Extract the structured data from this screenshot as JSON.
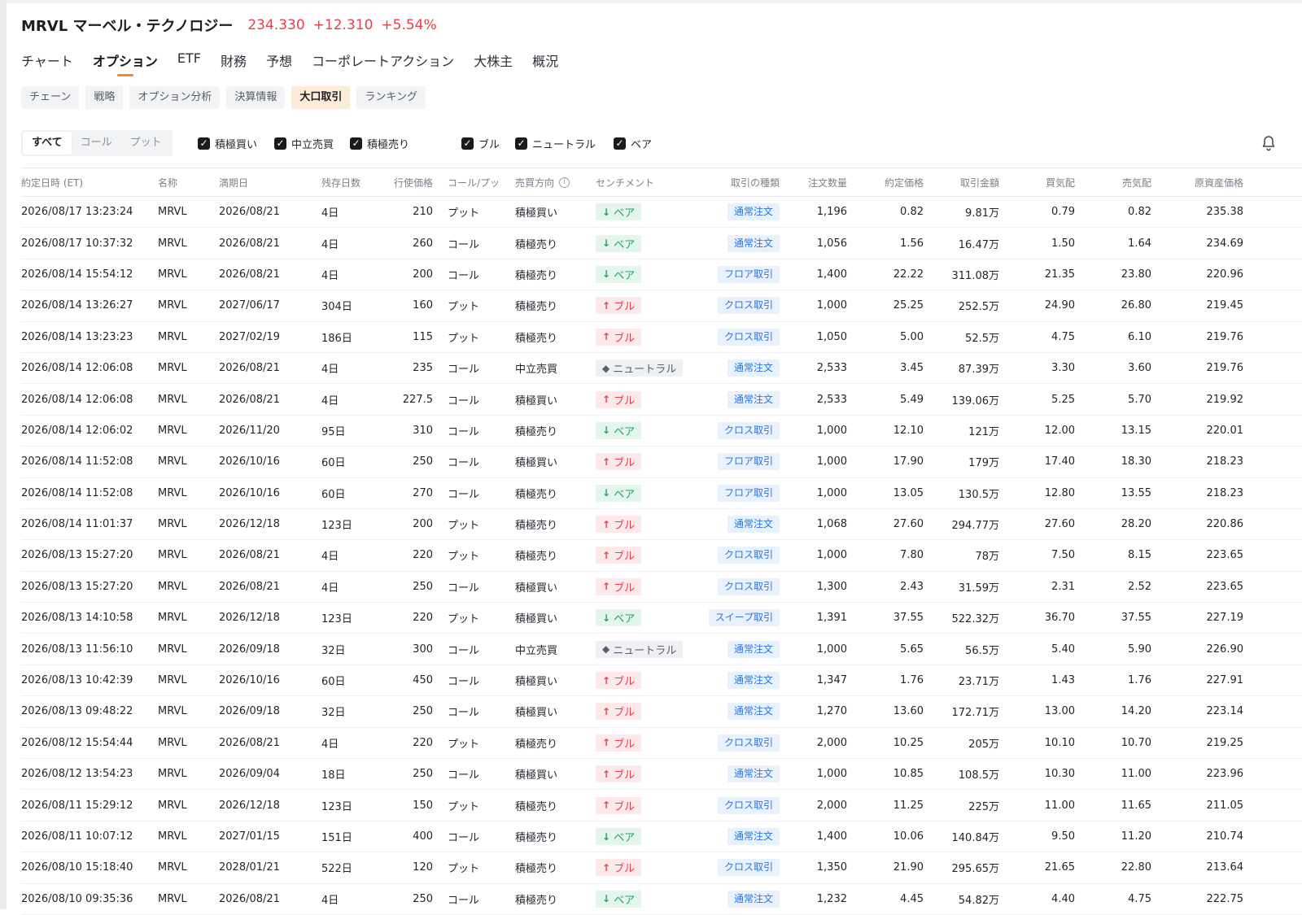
{
  "header": {
    "ticker": "MRVL マーベル・テクノロジー",
    "price": "234.330",
    "change": "+12.310",
    "change_pct": "+5.54%",
    "up_color": "#e5404a"
  },
  "tabs": [
    "チャート",
    "オプション",
    "ETF",
    "財務",
    "予想",
    "コーポレートアクション",
    "大株主",
    "概況"
  ],
  "active_tab": "オプション",
  "subtabs": [
    "チェーン",
    "戦略",
    "オプション分析",
    "決算情報",
    "大口取引",
    "ランキング"
  ],
  "active_subtab": "大口取引",
  "filters": {
    "segment": [
      "すべて",
      "コール",
      "プット"
    ],
    "segment_active": "すべて",
    "trade_checks": [
      "積極買い",
      "中立売買",
      "積極売り"
    ],
    "sentiment_checks": [
      "ブル",
      "ニュートラル",
      "ベア"
    ],
    "checked": true
  },
  "icons": {
    "bell": "bell-icon",
    "info": "info-icon",
    "checkbox": "checkbox-icon"
  },
  "columns": [
    "約定日時 (ET)",
    "名称",
    "満期日",
    "残存日数",
    "行使価格",
    "コール/プッ",
    "売買方向",
    "センチメント",
    "取引の種類",
    "注文数量",
    "約定価格",
    "取引金額",
    "買気配",
    "売気配",
    "原資産価格"
  ],
  "sentiment_colors": {
    "ブル": "#e5404a",
    "ベア": "#19a560",
    "ニュートラル": "#5a606b"
  },
  "rows": [
    [
      "2026/08/17 13:23:24",
      "MRVL",
      "2026/08/21",
      "4日",
      "210",
      "プット",
      "積極買い",
      "ベア",
      "通常注文",
      "1,196",
      "0.82",
      "9.81万",
      "0.79",
      "0.82",
      "235.38"
    ],
    [
      "2026/08/17 10:37:32",
      "MRVL",
      "2026/08/21",
      "4日",
      "260",
      "コール",
      "積極売り",
      "ベア",
      "通常注文",
      "1,056",
      "1.56",
      "16.47万",
      "1.50",
      "1.64",
      "234.69"
    ],
    [
      "2026/08/14 15:54:12",
      "MRVL",
      "2026/08/21",
      "4日",
      "200",
      "コール",
      "積極売り",
      "ベア",
      "フロア取引",
      "1,400",
      "22.22",
      "311.08万",
      "21.35",
      "23.80",
      "220.96"
    ],
    [
      "2026/08/14 13:26:27",
      "MRVL",
      "2027/06/17",
      "304日",
      "160",
      "プット",
      "積極売り",
      "ブル",
      "クロス取引",
      "1,000",
      "25.25",
      "252.5万",
      "24.90",
      "26.80",
      "219.45"
    ],
    [
      "2026/08/14 13:23:23",
      "MRVL",
      "2027/02/19",
      "186日",
      "115",
      "プット",
      "積極売り",
      "ブル",
      "クロス取引",
      "1,050",
      "5.00",
      "52.5万",
      "4.75",
      "6.10",
      "219.76"
    ],
    [
      "2026/08/14 12:06:08",
      "MRVL",
      "2026/08/21",
      "4日",
      "235",
      "コール",
      "中立売買",
      "ニュートラル",
      "通常注文",
      "2,533",
      "3.45",
      "87.39万",
      "3.30",
      "3.60",
      "219.76"
    ],
    [
      "2026/08/14 12:06:08",
      "MRVL",
      "2026/08/21",
      "4日",
      "227.5",
      "コール",
      "積極買い",
      "ブル",
      "通常注文",
      "2,533",
      "5.49",
      "139.06万",
      "5.25",
      "5.70",
      "219.92"
    ],
    [
      "2026/08/14 12:06:02",
      "MRVL",
      "2026/11/20",
      "95日",
      "310",
      "コール",
      "積極売り",
      "ベア",
      "クロス取引",
      "1,000",
      "12.10",
      "121万",
      "12.00",
      "13.15",
      "220.01"
    ],
    [
      "2026/08/14 11:52:08",
      "MRVL",
      "2026/10/16",
      "60日",
      "250",
      "コール",
      "積極買い",
      "ブル",
      "フロア取引",
      "1,000",
      "17.90",
      "179万",
      "17.40",
      "18.30",
      "218.23"
    ],
    [
      "2026/08/14 11:52:08",
      "MRVL",
      "2026/10/16",
      "60日",
      "270",
      "コール",
      "積極売り",
      "ベア",
      "フロア取引",
      "1,000",
      "13.05",
      "130.5万",
      "12.80",
      "13.55",
      "218.23"
    ],
    [
      "2026/08/14 11:01:37",
      "MRVL",
      "2026/12/18",
      "123日",
      "200",
      "プット",
      "積極売り",
      "ブル",
      "通常注文",
      "1,068",
      "27.60",
      "294.77万",
      "27.60",
      "28.20",
      "220.86"
    ],
    [
      "2026/08/13 15:27:20",
      "MRVL",
      "2026/08/21",
      "4日",
      "220",
      "プット",
      "積極売り",
      "ブル",
      "クロス取引",
      "1,000",
      "7.80",
      "78万",
      "7.50",
      "8.15",
      "223.65"
    ],
    [
      "2026/08/13 15:27:20",
      "MRVL",
      "2026/08/21",
      "4日",
      "250",
      "コール",
      "積極買い",
      "ブル",
      "クロス取引",
      "1,300",
      "2.43",
      "31.59万",
      "2.31",
      "2.52",
      "223.65"
    ],
    [
      "2026/08/13 14:10:58",
      "MRVL",
      "2026/12/18",
      "123日",
      "220",
      "プット",
      "積極買い",
      "ベア",
      "スイープ取引",
      "1,391",
      "37.55",
      "522.32万",
      "36.70",
      "37.55",
      "227.19"
    ],
    [
      "2026/08/13 11:56:10",
      "MRVL",
      "2026/09/18",
      "32日",
      "300",
      "コール",
      "中立売買",
      "ニュートラル",
      "通常注文",
      "1,000",
      "5.65",
      "56.5万",
      "5.40",
      "5.90",
      "226.90"
    ],
    [
      "2026/08/13 10:42:39",
      "MRVL",
      "2026/10/16",
      "60日",
      "450",
      "コール",
      "積極買い",
      "ブル",
      "通常注文",
      "1,347",
      "1.76",
      "23.71万",
      "1.43",
      "1.76",
      "227.91"
    ],
    [
      "2026/08/13 09:48:22",
      "MRVL",
      "2026/09/18",
      "32日",
      "250",
      "コール",
      "積極買い",
      "ブル",
      "通常注文",
      "1,270",
      "13.60",
      "172.71万",
      "13.00",
      "14.20",
      "223.14"
    ],
    [
      "2026/08/12 15:54:44",
      "MRVL",
      "2026/08/21",
      "4日",
      "220",
      "プット",
      "積極売り",
      "ブル",
      "クロス取引",
      "2,000",
      "10.25",
      "205万",
      "10.10",
      "10.70",
      "219.25"
    ],
    [
      "2026/08/12 13:54:23",
      "MRVL",
      "2026/09/04",
      "18日",
      "250",
      "コール",
      "積極買い",
      "ブル",
      "通常注文",
      "1,000",
      "10.85",
      "108.5万",
      "10.30",
      "11.00",
      "223.96"
    ],
    [
      "2026/08/11 15:29:12",
      "MRVL",
      "2026/12/18",
      "123日",
      "150",
      "プット",
      "積極売り",
      "ブル",
      "クロス取引",
      "2,000",
      "11.25",
      "225万",
      "11.00",
      "11.65",
      "211.05"
    ],
    [
      "2026/08/11 10:07:12",
      "MRVL",
      "2027/01/15",
      "151日",
      "400",
      "コール",
      "積極売り",
      "ベア",
      "通常注文",
      "1,400",
      "10.06",
      "140.84万",
      "9.50",
      "11.20",
      "210.74"
    ],
    [
      "2026/08/10 15:18:40",
      "MRVL",
      "2028/01/21",
      "522日",
      "120",
      "プット",
      "積極売り",
      "ブル",
      "クロス取引",
      "1,350",
      "21.90",
      "295.65万",
      "21.65",
      "22.80",
      "213.64"
    ],
    [
      "2026/08/10 09:35:36",
      "MRVL",
      "2026/08/21",
      "4日",
      "250",
      "コール",
      "積極売り",
      "ベア",
      "通常注文",
      "1,232",
      "4.45",
      "54.82万",
      "4.40",
      "4.75",
      "222.75"
    ]
  ]
}
